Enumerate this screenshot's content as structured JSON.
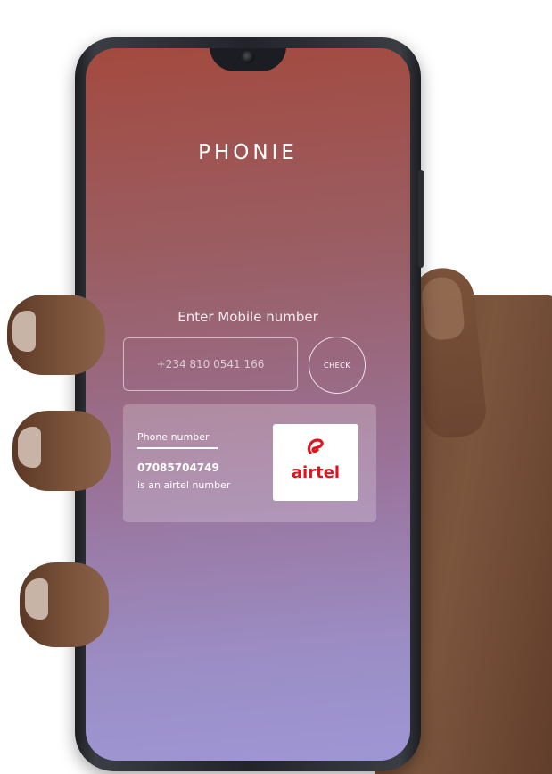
{
  "app": {
    "title": "PHONIE"
  },
  "lookup": {
    "prompt": "Enter Mobile number",
    "input_placeholder": "+234 810 0541 166",
    "check_label": "CHECK"
  },
  "result": {
    "label": "Phone number",
    "number": "07085704749",
    "carrier_text": "is an airtel number",
    "carrier_logo_text": "airtel"
  },
  "colors": {
    "gradient_top": "#a34a3f",
    "gradient_bottom": "#9e96d4",
    "airtel_red": "#e0141e"
  }
}
